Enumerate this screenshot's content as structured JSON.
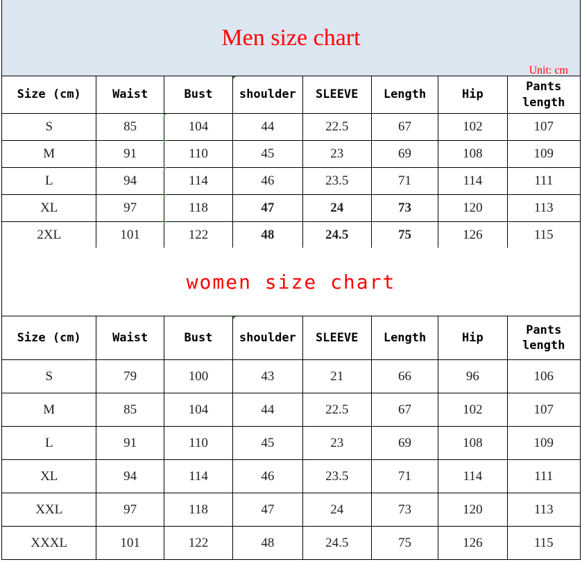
{
  "men": {
    "title": "Men size chart",
    "unit": "Unit: cm",
    "headers": [
      "Size (cm)",
      "Waist",
      "Bust",
      "shoulder",
      "SLEEVE",
      "Length",
      "Hip",
      "Pants\nlength"
    ],
    "rows": [
      [
        "S",
        "85",
        "104",
        "44",
        "22.5",
        "67",
        "102",
        "107"
      ],
      [
        "M",
        "91",
        "110",
        "45",
        "23",
        "69",
        "108",
        "109"
      ],
      [
        "L",
        "94",
        "114",
        "46",
        "23.5",
        "71",
        "114",
        "111"
      ],
      [
        "XL",
        "97",
        "118",
        "47",
        "24",
        "73",
        "120",
        "113"
      ],
      [
        "2XL",
        "101",
        "122",
        "48",
        "24.5",
        "75",
        "126",
        "115"
      ]
    ]
  },
  "women": {
    "title": "women size chart",
    "headers": [
      "Size (cm)",
      "Waist",
      "Bust",
      "shoulder",
      "SLEEVE",
      "Length",
      "Hip",
      "Pants\nlength"
    ],
    "rows": [
      [
        "S",
        "79",
        "100",
        "43",
        "21",
        "66",
        "96",
        "106"
      ],
      [
        "M",
        "85",
        "104",
        "44",
        "22.5",
        "67",
        "102",
        "107"
      ],
      [
        "L",
        "91",
        "110",
        "45",
        "23",
        "69",
        "108",
        "109"
      ],
      [
        "XL",
        "94",
        "114",
        "46",
        "23.5",
        "71",
        "114",
        "111"
      ],
      [
        "XXL",
        "97",
        "118",
        "47",
        "24",
        "73",
        "120",
        "113"
      ],
      [
        "XXXL",
        "101",
        "122",
        "48",
        "24.5",
        "75",
        "126",
        "115"
      ]
    ]
  },
  "colors": {
    "title_red": "#ff0000",
    "header_band": "#dce6f1"
  }
}
